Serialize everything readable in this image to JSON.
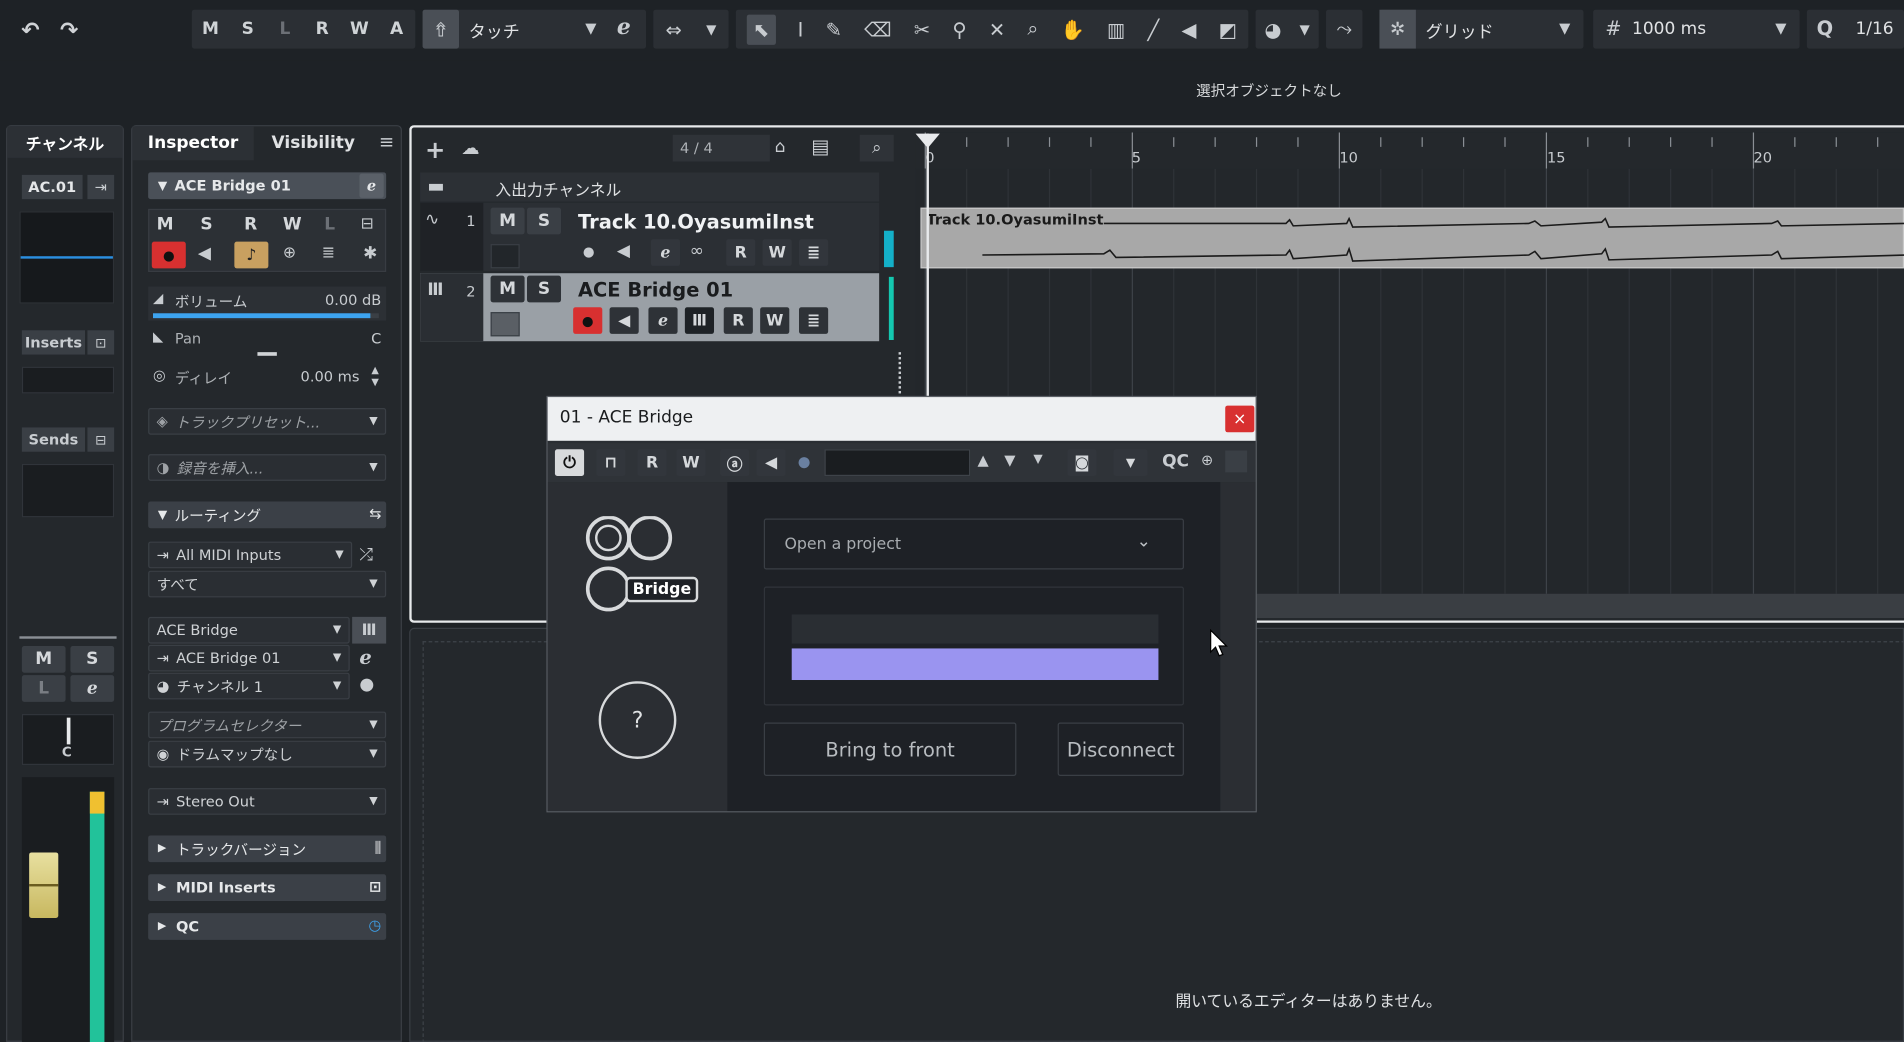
{
  "toolbar": {
    "automation_mode": "タッチ",
    "snap_type": "グリッド",
    "grid_value": "1000 ms",
    "quantize": "1/16",
    "mode_letters": [
      "M",
      "S",
      "L",
      "R",
      "W",
      "A"
    ]
  },
  "status": {
    "selection": "選択オブジェクトなし",
    "editor_empty": "開いているエディターはありません。"
  },
  "channel_panel": {
    "tab": "チャンネル",
    "id": "AC.01",
    "inserts": "Inserts",
    "sends": "Sends",
    "ms": [
      "M",
      "S"
    ],
    "le": [
      "L"
    ],
    "pan_value": "C"
  },
  "inspector": {
    "tab": "Inspector",
    "visibility_tab": "Visibility",
    "track_name": "ACE Bridge 01",
    "letters": [
      "M",
      "S",
      "R",
      "W",
      "L"
    ],
    "volume_label": "ボリューム",
    "volume_value": "0.00 dB",
    "volume_level": 0.96,
    "pan_label": "Pan",
    "pan_value": "C",
    "delay_label": "ディレイ",
    "delay_value": "0.00 ms",
    "track_preset": "トラックプリセット...",
    "record_insert": "録音を挿入...",
    "routing": "ルーティング",
    "midi_input": "All MIDI Inputs",
    "channel_all": "すべて",
    "output_device": "ACE Bridge",
    "output_name": "ACE Bridge 01",
    "channel_1": "チャンネル 1",
    "program_selector": "プログラムセレクター",
    "drum_map": "ドラムマップなし",
    "stereo_out": "Stereo Out",
    "track_version": "トラックバージョン",
    "midi_inserts": "MIDI Inserts",
    "qc": "QC"
  },
  "tracklist": {
    "count": "4 / 4",
    "io_channel": "入出力チャンネル",
    "tracks": [
      {
        "num": "1",
        "name": "Track 10.OyasumiInst"
      },
      {
        "num": "2",
        "name": "ACE Bridge 01"
      }
    ],
    "ms": [
      "M",
      "S"
    ],
    "rw": [
      "R",
      "W"
    ]
  },
  "ruler": {
    "marks": [
      "0",
      "5",
      "10",
      "15",
      "20"
    ]
  },
  "clip": {
    "name": "Track 10.OyasumiInst"
  },
  "plugin": {
    "title": "01 - ACE Bridge",
    "toolbar_letters": [
      "R",
      "W"
    ],
    "qc": "QC",
    "logo_text": "Bridge",
    "help": "?",
    "project_placeholder": "Open a project",
    "progress": 1.0,
    "bring_to_front": "Bring to front",
    "disconnect": "Disconnect"
  }
}
